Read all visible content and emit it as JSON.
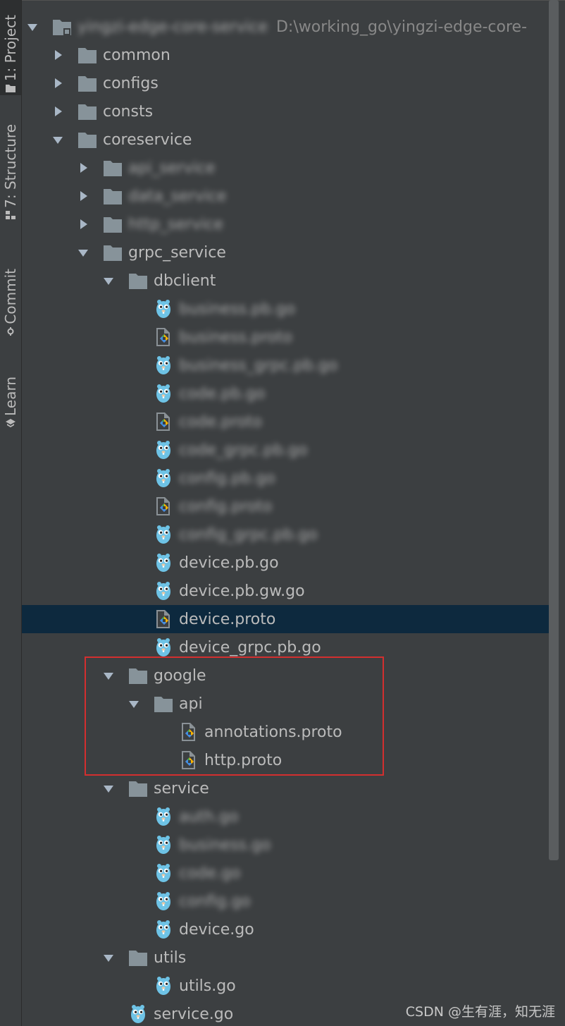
{
  "sidebar": {
    "tabs": [
      {
        "label": "1: Project",
        "icon": "folder-icon",
        "active": true
      },
      {
        "label": "7: Structure",
        "icon": "structure-icon",
        "active": false
      },
      {
        "label": "Commit",
        "icon": "commit-icon",
        "active": false
      },
      {
        "label": "Learn",
        "icon": "learn-icon",
        "active": false
      }
    ]
  },
  "tree": {
    "rows": [
      {
        "label": "yingzi-edge-core-service",
        "path": "D:\\working_go\\yingzi-edge-core-",
        "type": "module-folder",
        "depth": 0,
        "expanded": true,
        "blurred": true
      },
      {
        "label": "common",
        "type": "folder",
        "depth": 1,
        "expanded": false
      },
      {
        "label": "configs",
        "type": "folder",
        "depth": 1,
        "expanded": false
      },
      {
        "label": "consts",
        "type": "folder",
        "depth": 1,
        "expanded": false
      },
      {
        "label": "coreservice",
        "type": "folder",
        "depth": 1,
        "expanded": true
      },
      {
        "label": "api_service",
        "type": "folder",
        "depth": 2,
        "expanded": false,
        "blurred": true
      },
      {
        "label": "data_service",
        "type": "folder",
        "depth": 2,
        "expanded": false,
        "blurred": true
      },
      {
        "label": "http_service",
        "type": "folder",
        "depth": 2,
        "expanded": false,
        "blurred": true
      },
      {
        "label": "grpc_service",
        "type": "folder",
        "depth": 2,
        "expanded": true
      },
      {
        "label": "dbclient",
        "type": "folder",
        "depth": 3,
        "expanded": true
      },
      {
        "label": "business.pb.go",
        "type": "go",
        "depth": 4,
        "blurred": true
      },
      {
        "label": "business.proto",
        "type": "proto",
        "depth": 4,
        "blurred": true
      },
      {
        "label": "business_grpc.pb.go",
        "type": "go",
        "depth": 4,
        "blurred": true
      },
      {
        "label": "code.pb.go",
        "type": "go",
        "depth": 4,
        "blurred": true
      },
      {
        "label": "code.proto",
        "type": "proto",
        "depth": 4,
        "blurred": true
      },
      {
        "label": "code_grpc.pb.go",
        "type": "go",
        "depth": 4,
        "blurred": true
      },
      {
        "label": "config.pb.go",
        "type": "go",
        "depth": 4,
        "blurred": true
      },
      {
        "label": "config.proto",
        "type": "proto",
        "depth": 4,
        "blurred": true
      },
      {
        "label": "config_grpc.pb.go",
        "type": "go",
        "depth": 4,
        "blurred": true
      },
      {
        "label": "device.pb.go",
        "type": "go",
        "depth": 4
      },
      {
        "label": "device.pb.gw.go",
        "type": "go",
        "depth": 4
      },
      {
        "label": "device.proto",
        "type": "proto",
        "depth": 4,
        "selected": true
      },
      {
        "label": "device_grpc.pb.go",
        "type": "go",
        "depth": 4
      },
      {
        "label": "google",
        "type": "folder",
        "depth": 3,
        "expanded": true
      },
      {
        "label": "api",
        "type": "folder",
        "depth": 4,
        "expanded": true
      },
      {
        "label": "annotations.proto",
        "type": "proto",
        "depth": 5
      },
      {
        "label": "http.proto",
        "type": "proto",
        "depth": 5
      },
      {
        "label": "service",
        "type": "folder",
        "depth": 3,
        "expanded": true
      },
      {
        "label": "auth.go",
        "type": "go",
        "depth": 4,
        "blurred": true
      },
      {
        "label": "business.go",
        "type": "go",
        "depth": 4,
        "blurred": true
      },
      {
        "label": "code.go",
        "type": "go",
        "depth": 4,
        "blurred": true
      },
      {
        "label": "config.go",
        "type": "go",
        "depth": 4,
        "blurred": true
      },
      {
        "label": "device.go",
        "type": "go",
        "depth": 4
      },
      {
        "label": "utils",
        "type": "folder",
        "depth": 3,
        "expanded": true
      },
      {
        "label": "utils.go",
        "type": "go",
        "depth": 4
      },
      {
        "label": "service.go",
        "type": "go",
        "depth": 3
      }
    ]
  },
  "watermark": "CSDN @生有涯，知无涯",
  "colors": {
    "background": "#3c3f41",
    "selection": "#0d293e",
    "text": "#bbbbbb",
    "folder": "#87939a",
    "gopher": "#6ec3e6",
    "highlight_box": "#d32f2f"
  }
}
